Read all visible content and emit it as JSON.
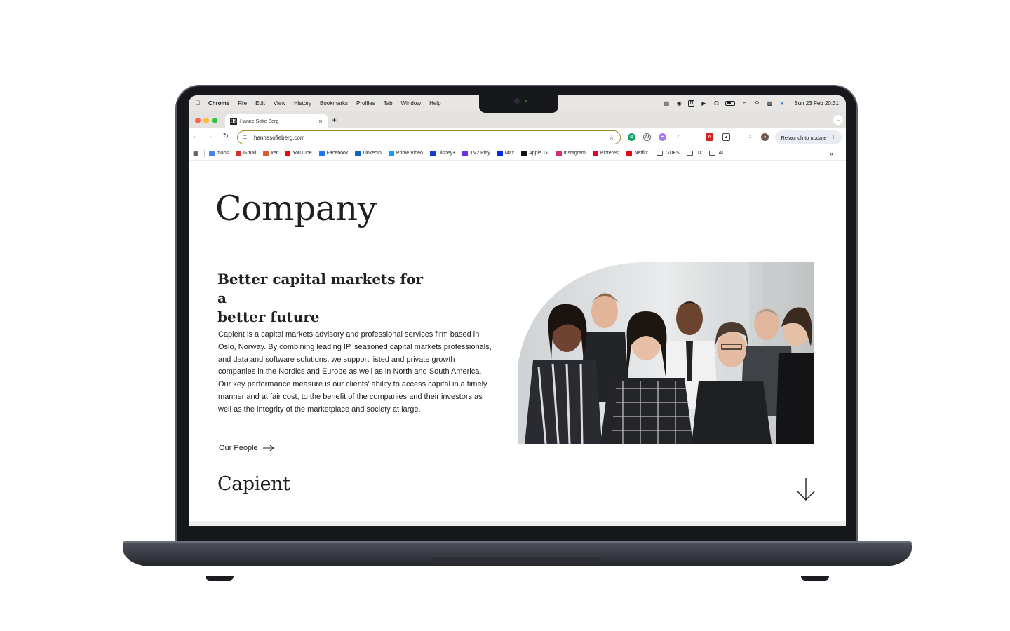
{
  "menubar": {
    "app_name": "Chrome",
    "items": [
      "File",
      "Edit",
      "View",
      "History",
      "Bookmarks",
      "Profiles",
      "Tab",
      "Window",
      "Help"
    ],
    "clock": "Sun 23 Feb  20:31"
  },
  "tab": {
    "title": "Hanne Sofie Berg",
    "favicon": "HS",
    "close": "×",
    "new_tab": "+"
  },
  "toolbar": {
    "url": "hannesofieberg.com",
    "relaunch_label": "Relaunch to update",
    "more": "⋮"
  },
  "bookmarks": [
    {
      "label": "maps",
      "icon": "maps-icon",
      "color": "#4285f4"
    },
    {
      "label": "Gmail",
      "icon": "gmail-icon",
      "color": "#d93025"
    },
    {
      "label": "xer",
      "icon": "xer-icon",
      "color": "#e05a2b"
    },
    {
      "label": "YouTube",
      "icon": "youtube-icon",
      "color": "#ff0000"
    },
    {
      "label": "Facebook",
      "icon": "facebook-icon",
      "color": "#1877f2"
    },
    {
      "label": "LinkedIn",
      "icon": "linkedin-icon",
      "color": "#0a66c2"
    },
    {
      "label": "Prime Video",
      "icon": "prime-video-icon",
      "color": "#1399ff"
    },
    {
      "label": "Disney+",
      "icon": "disney-icon",
      "color": "#113ccf"
    },
    {
      "label": "TV2 Play",
      "icon": "tv2-icon",
      "color": "#6b2fe6"
    },
    {
      "label": "Max",
      "icon": "max-icon",
      "color": "#002be7"
    },
    {
      "label": "Apple TV",
      "icon": "apple-tv-icon",
      "color": "#111111"
    },
    {
      "label": "Instagram",
      "icon": "instagram-icon",
      "color": "#d62976"
    },
    {
      "label": "Pinterest",
      "icon": "pinterest-icon",
      "color": "#e60023"
    },
    {
      "label": "Netflix",
      "icon": "netflix-icon",
      "color": "#e50914"
    }
  ],
  "bookmark_folders": [
    "GDES",
    "UX",
    "AI"
  ],
  "page": {
    "title": "Company",
    "headline_line1": "Better capital markets for a",
    "headline_line2": "better future",
    "body": "Capient is a capital markets advisory and professional services firm based in Oslo, Norway. By combining leading IP, seasoned capital markets professionals, and data and software solutions, we support listed and private growth companies in the Nordics and Europe as well as in North and South America. Our key performance measure is our clients’ ability to access capital in a timely manner and at fair cost, to the benefit of the companies and their investors as well as the integrity of the marketplace and society at large.",
    "people_link": "Our People",
    "brand": "Capient"
  },
  "colors": {
    "omnibox_border": "#9a8a2c",
    "traffic_close": "#ff5f57",
    "traffic_min": "#febc2e",
    "traffic_max": "#28c840"
  }
}
